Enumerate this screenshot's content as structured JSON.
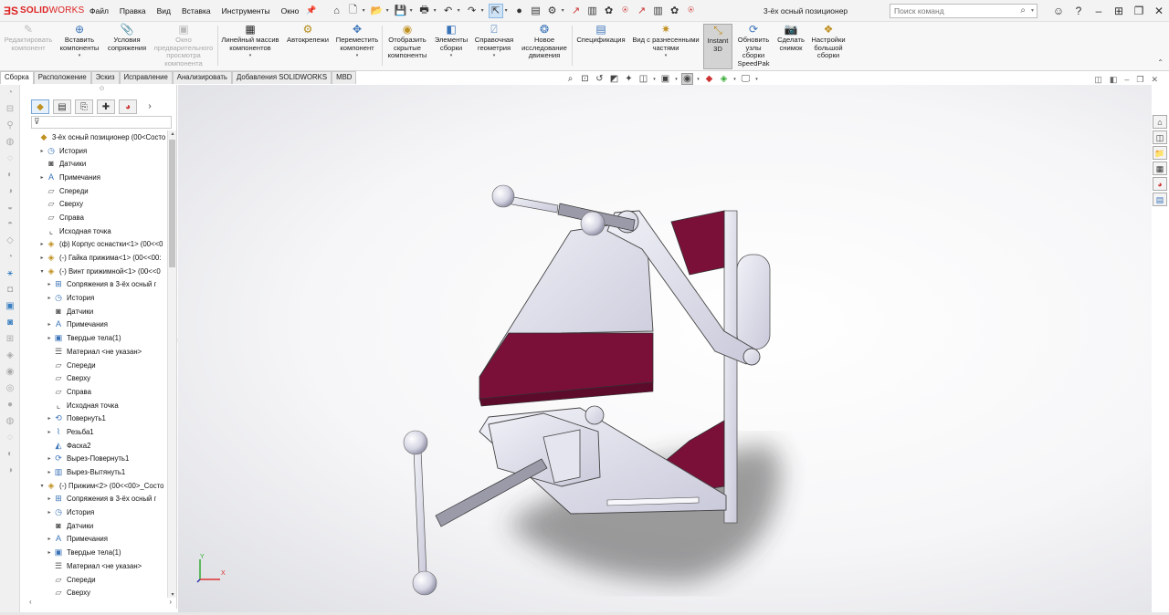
{
  "app": {
    "logo_ds": "ƎS",
    "logo_solid": "SOLID",
    "logo_works": "WORKS",
    "document_title": "3-ёх осный позиционер"
  },
  "menu": [
    "Файл",
    "Правка",
    "Вид",
    "Вставка",
    "Инструменты",
    "Окно"
  ],
  "quick_toolbar_icons": [
    "home-icon",
    "new-icon",
    "open-icon",
    "save-icon",
    "print-icon",
    "undo-icon",
    "redo-icon",
    "select-icon",
    "traffic-light-icon",
    "file-properties-icon",
    "options-icon"
  ],
  "search": {
    "placeholder": "Поиск команд"
  },
  "command_manager": [
    {
      "label": "Редактировать компонент",
      "icon": "edit-component-icon",
      "disabled": true
    },
    {
      "label": "Вставить компоненты",
      "icon": "insert-component-icon",
      "disabled": false
    },
    {
      "label": "Условия сопряжения",
      "icon": "mate-icon",
      "disabled": false
    },
    {
      "label": "Окно предварительного просмотра компонента",
      "icon": "preview-window-icon",
      "disabled": true
    },
    {
      "label": "Линейный массив компонентов",
      "icon": "linear-pattern-icon",
      "disabled": false
    },
    {
      "label": "Автокрепежи",
      "icon": "smart-fasteners-icon",
      "disabled": false
    },
    {
      "label": "Переместить компонент",
      "icon": "move-component-icon",
      "disabled": false
    },
    {
      "label": "Отобразить скрытые компоненты",
      "icon": "show-hidden-icon",
      "disabled": false
    },
    {
      "label": "Элементы сборки",
      "icon": "assembly-features-icon",
      "disabled": false
    },
    {
      "label": "Справочная геометрия",
      "icon": "reference-geometry-icon",
      "disabled": false
    },
    {
      "label": "Новое исследование движения",
      "icon": "motion-study-icon",
      "disabled": false
    },
    {
      "label": "Спецификация",
      "icon": "bom-icon",
      "disabled": false
    },
    {
      "label": "Вид с разнесенными частями",
      "icon": "exploded-view-icon",
      "disabled": false
    },
    {
      "label": "Instant 3D",
      "icon": "instant3d-icon",
      "disabled": false,
      "active": true
    },
    {
      "label": "Обновить узлы сборки SpeedPak",
      "icon": "speedpak-icon",
      "disabled": false
    },
    {
      "label": "Сделать снимок",
      "icon": "snapshot-icon",
      "disabled": false
    },
    {
      "label": "Настройки большой сборки",
      "icon": "large-assembly-icon",
      "disabled": false
    }
  ],
  "tabs": [
    "Сборка",
    "Расположение",
    "Эскиз",
    "Исправление",
    "Анализировать",
    "Добавления SOLIDWORKS",
    "MBD"
  ],
  "feature_tree": [
    {
      "label": "3-ёх осный позиционер  (00<Состо",
      "icon": "assembly-icon",
      "level": 0,
      "expander": ""
    },
    {
      "label": "История",
      "icon": "history-icon",
      "level": 1,
      "expander": "▸"
    },
    {
      "label": "Датчики",
      "icon": "sensor-icon",
      "level": 1,
      "expander": ""
    },
    {
      "label": "Примечания",
      "icon": "annotations-icon",
      "level": 1,
      "expander": "▸"
    },
    {
      "label": "Спереди",
      "icon": "plane-icon",
      "level": 1,
      "expander": ""
    },
    {
      "label": "Сверху",
      "icon": "plane-icon",
      "level": 1,
      "expander": ""
    },
    {
      "label": "Справа",
      "icon": "plane-icon",
      "level": 1,
      "expander": ""
    },
    {
      "label": "Исходная точка",
      "icon": "origin-icon",
      "level": 1,
      "expander": ""
    },
    {
      "label": "(ф) Корпус оснастки<1> (00<<0",
      "icon": "part-icon",
      "level": 1,
      "expander": "▸"
    },
    {
      "label": "(-) Гайка прижима<1> (00<<00:",
      "icon": "part-icon",
      "level": 1,
      "expander": "▸"
    },
    {
      "label": "(-) Винт прижимной<1> (00<<0",
      "icon": "part-icon",
      "level": 1,
      "expander": "▾"
    },
    {
      "label": "Сопряжения в 3-ёх осный г",
      "icon": "mates-folder-icon",
      "level": 2,
      "expander": "▸"
    },
    {
      "label": "История",
      "icon": "history-icon",
      "level": 2,
      "expander": "▸"
    },
    {
      "label": "Датчики",
      "icon": "sensor-icon",
      "level": 2,
      "expander": ""
    },
    {
      "label": "Примечания",
      "icon": "annotations-icon",
      "level": 2,
      "expander": "▸"
    },
    {
      "label": "Твердые тела(1)",
      "icon": "solid-bodies-icon",
      "level": 2,
      "expander": "▸"
    },
    {
      "label": "Материал <не указан>",
      "icon": "material-icon",
      "level": 2,
      "expander": ""
    },
    {
      "label": "Спереди",
      "icon": "plane-icon",
      "level": 2,
      "expander": ""
    },
    {
      "label": "Сверху",
      "icon": "plane-icon",
      "level": 2,
      "expander": ""
    },
    {
      "label": "Справа",
      "icon": "plane-icon",
      "level": 2,
      "expander": ""
    },
    {
      "label": "Исходная точка",
      "icon": "origin-icon",
      "level": 2,
      "expander": ""
    },
    {
      "label": "Повернуть1",
      "icon": "revolve-icon",
      "level": 2,
      "expander": "▸"
    },
    {
      "label": "Резьба1",
      "icon": "thread-icon",
      "level": 2,
      "expander": "▸"
    },
    {
      "label": "Фаска2",
      "icon": "chamfer-icon",
      "level": 2,
      "expander": ""
    },
    {
      "label": "Вырез-Повернуть1",
      "icon": "revolve-cut-icon",
      "level": 2,
      "expander": "▸"
    },
    {
      "label": "Вырез-Вытянуть1",
      "icon": "extrude-cut-icon",
      "level": 2,
      "expander": "▸"
    },
    {
      "label": "(-) Прижим<2> (00<<00>_Состо",
      "icon": "part-icon",
      "level": 1,
      "expander": "▾"
    },
    {
      "label": "Сопряжения в 3-ёх осный г",
      "icon": "mates-folder-icon",
      "level": 2,
      "expander": "▸"
    },
    {
      "label": "История",
      "icon": "history-icon",
      "level": 2,
      "expander": "▸"
    },
    {
      "label": "Датчики",
      "icon": "sensor-icon",
      "level": 2,
      "expander": ""
    },
    {
      "label": "Примечания",
      "icon": "annotations-icon",
      "level": 2,
      "expander": "▸"
    },
    {
      "label": "Твердые тела(1)",
      "icon": "solid-bodies-icon",
      "level": 2,
      "expander": "▸"
    },
    {
      "label": "Материал <не указан>",
      "icon": "material-icon",
      "level": 2,
      "expander": ""
    },
    {
      "label": "Спереди",
      "icon": "plane-icon",
      "level": 2,
      "expander": ""
    },
    {
      "label": "Сверху",
      "icon": "plane-icon",
      "level": 2,
      "expander": ""
    }
  ],
  "triad": {
    "x": "X",
    "y": "Y"
  },
  "colors": {
    "brand": "#d22020",
    "part_face": "#d8d8e8",
    "accent_face": "#7a1038",
    "selection": "#cfe3f7"
  }
}
